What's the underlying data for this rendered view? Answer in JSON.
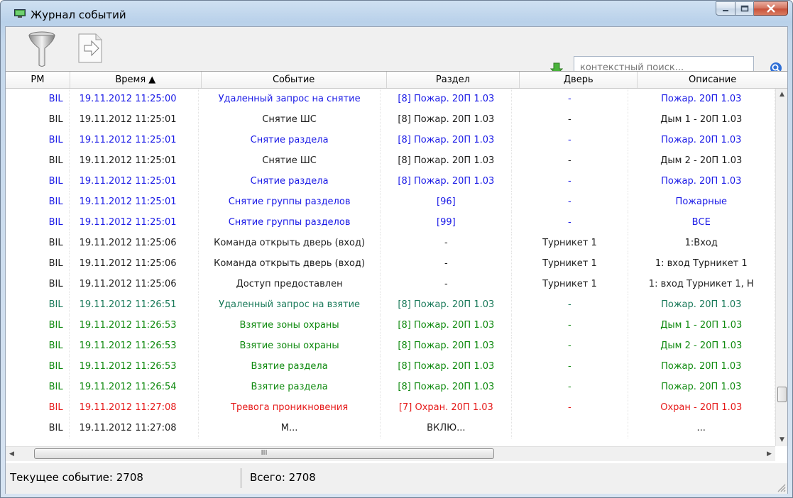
{
  "window": {
    "title": "Журнал событий",
    "minimize": "–",
    "maximize": "□",
    "close": "x"
  },
  "toolbar": {
    "search_placeholder": "контекстный поиск...",
    "filter_icon": "funnel-icon",
    "export_icon": "export-icon",
    "arrow_icon": "green-down-arrow-icon",
    "search_icon": "magnifier-icon"
  },
  "colors": {
    "blue": "#1a1ae6",
    "black": "#1e1e1e",
    "green": "#0f8a0f",
    "teal": "#1a7a5a",
    "red": "#e61a1a"
  },
  "table": {
    "columns": [
      "РМ",
      "Время  ▲",
      "Событие",
      "Раздел",
      "Дверь",
      "Описание"
    ],
    "rows": [
      {
        "color": "blue",
        "cells": [
          "BIL",
          "19.11.2012 11:25:00",
          "Удаленный запрос на снятие",
          "[8] Пожар. 20П 1.03",
          "-",
          "Пожар. 20П 1.03"
        ]
      },
      {
        "color": "black",
        "cells": [
          "BIL",
          "19.11.2012 11:25:01",
          "Снятие ШС",
          "[8] Пожар. 20П 1.03",
          "-",
          "Дым 1 - 20П 1.03"
        ]
      },
      {
        "color": "blue",
        "cells": [
          "BIL",
          "19.11.2012 11:25:01",
          "Снятие раздела",
          "[8] Пожар. 20П 1.03",
          "-",
          "Пожар. 20П 1.03"
        ]
      },
      {
        "color": "black",
        "cells": [
          "BIL",
          "19.11.2012 11:25:01",
          "Снятие ШС",
          "[8] Пожар. 20П 1.03",
          "-",
          "Дым 2 - 20П 1.03"
        ]
      },
      {
        "color": "blue",
        "cells": [
          "BIL",
          "19.11.2012 11:25:01",
          "Снятие раздела",
          "[8] Пожар. 20П 1.03",
          "-",
          "Пожар. 20П 1.03"
        ]
      },
      {
        "color": "blue",
        "cells": [
          "BIL",
          "19.11.2012 11:25:01",
          "Снятие группы разделов",
          "[96]",
          "-",
          "Пожарные"
        ]
      },
      {
        "color": "blue",
        "cells": [
          "BIL",
          "19.11.2012 11:25:01",
          "Снятие группы разделов",
          "[99]",
          "-",
          "ВСЕ"
        ]
      },
      {
        "color": "black",
        "cells": [
          "BIL",
          "19.11.2012 11:25:06",
          "Команда открыть дверь (вход)",
          "-",
          "Турникет 1",
          "1:Вход"
        ]
      },
      {
        "color": "black",
        "cells": [
          "BIL",
          "19.11.2012 11:25:06",
          "Команда открыть дверь (вход)",
          "-",
          "Турникет 1",
          "1: вход  Турникет 1"
        ]
      },
      {
        "color": "black",
        "cells": [
          "BIL",
          "19.11.2012 11:25:06",
          "Доступ предоставлен",
          "-",
          "Турникет 1",
          "1: вход  Турникет 1, Н"
        ]
      },
      {
        "color": "teal",
        "cells": [
          "BIL",
          "19.11.2012 11:26:51",
          "Удаленный запрос на взятие",
          "[8] Пожар. 20П 1.03",
          "-",
          "Пожар. 20П 1.03"
        ]
      },
      {
        "color": "green",
        "cells": [
          "BIL",
          "19.11.2012 11:26:53",
          "Взятие зоны охраны",
          "[8] Пожар. 20П 1.03",
          "-",
          "Дым 1 - 20П 1.03"
        ]
      },
      {
        "color": "green",
        "cells": [
          "BIL",
          "19.11.2012 11:26:53",
          "Взятие зоны охраны",
          "[8] Пожар. 20П 1.03",
          "-",
          "Дым 2 - 20П 1.03"
        ]
      },
      {
        "color": "green",
        "cells": [
          "BIL",
          "19.11.2012 11:26:53",
          "Взятие раздела",
          "[8] Пожар. 20П 1.03",
          "-",
          "Пожар. 20П 1.03"
        ]
      },
      {
        "color": "green",
        "cells": [
          "BIL",
          "19.11.2012 11:26:54",
          "Взятие раздела",
          "[8] Пожар. 20П 1.03",
          "-",
          "Пожар. 20П 1.03"
        ]
      },
      {
        "color": "red",
        "cells": [
          "BIL",
          "19.11.2012 11:27:08",
          "Тревога проникновения",
          "[7] Охран. 20П 1.03",
          "-",
          "Охран - 20П 1.03"
        ]
      },
      {
        "color": "black",
        "cells": [
          "BIL",
          "19.11.2012 11:27:08",
          "М...",
          "ВКЛЮ...",
          "",
          "..."
        ]
      }
    ]
  },
  "scroll": {
    "hscroll_grip": "III",
    "up_icon": "▲",
    "down_icon": "▼",
    "left_icon": "◀",
    "right_icon": "▶"
  },
  "status": {
    "current": "Текущее событие: 2708",
    "total": "Всего: 2708"
  }
}
